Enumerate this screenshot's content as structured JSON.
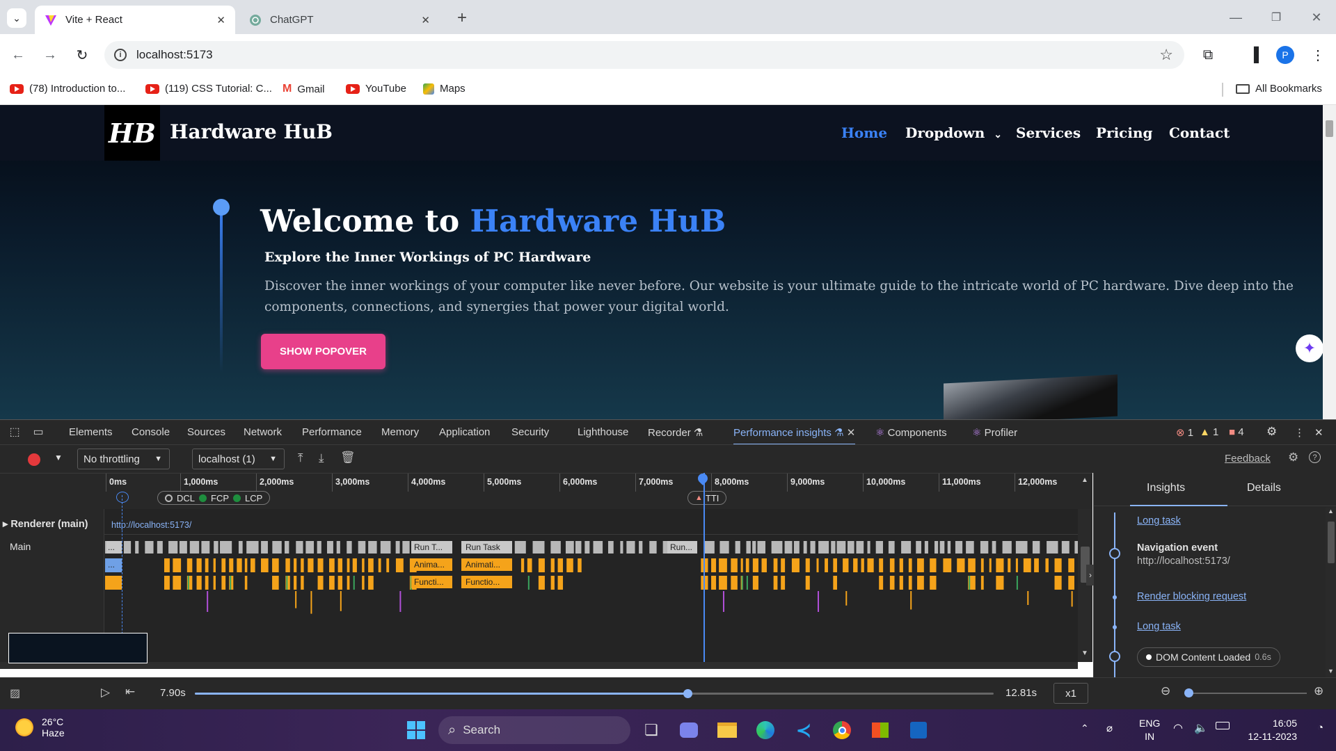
{
  "browser": {
    "tabs": [
      {
        "title": "Vite + React",
        "active": true
      },
      {
        "title": "ChatGPT",
        "active": false
      }
    ],
    "new_tab": "+",
    "url": "localhost:5173",
    "profile_initial": "P",
    "bookmarks": [
      {
        "label": "(78) Introduction to...",
        "icon": "youtube-icon"
      },
      {
        "label": "(119) CSS Tutorial: C...",
        "icon": "youtube-icon"
      },
      {
        "label": "Gmail",
        "icon": "gmail-icon"
      },
      {
        "label": "YouTube",
        "icon": "youtube-icon"
      },
      {
        "label": "Maps",
        "icon": "maps-icon"
      }
    ],
    "all_bookmarks": "All Bookmarks"
  },
  "site": {
    "logo_text": "HB",
    "brand": "Hardware HuB",
    "nav": [
      "Home",
      "Dropdown",
      "Services",
      "Pricing",
      "Contact"
    ],
    "hero_title_plain": "Welcome to ",
    "hero_title_highlight": "Hardware HuB",
    "hero_subtitle": "Explore the Inner Workings of PC Hardware",
    "hero_description": "Discover the inner workings of your computer like never before. Our website is your ultimate guide to the intricate world of PC hardware. Dive deep into the components, connections, and synergies that power your digital world.",
    "popover_button": "SHOW POPOVER",
    "accent": "#3b82f6",
    "button_color": "#e8408a"
  },
  "devtools": {
    "tabs": [
      "Elements",
      "Console",
      "Sources",
      "Network",
      "Performance",
      "Memory",
      "Application",
      "Security",
      "Lighthouse",
      "Recorder",
      "Performance insights",
      "Components",
      "Profiler"
    ],
    "active_tab": "Performance insights",
    "errors": "1",
    "warnings": "1",
    "issues": "4",
    "throttling": "No throttling",
    "target": "localhost (1)",
    "feedback": "Feedback",
    "ruler": [
      "0ms",
      "1,000ms",
      "2,000ms",
      "3,000ms",
      "4,000ms",
      "5,000ms",
      "6,000ms",
      "7,000ms",
      "8,000ms",
      "9,000ms",
      "10,000ms",
      "11,000ms",
      "12,000ms"
    ],
    "markers": {
      "dcl": "DCL",
      "fcp": "FCP",
      "lcp": "LCP",
      "tti": "TTI"
    },
    "track_title": "Renderer (main)",
    "track_url": "http://localhost:5173/",
    "main_label": "Main",
    "main_tasks": [
      {
        "label": "Run T...",
        "row": 0
      },
      {
        "label": "Run Task",
        "row": 0
      },
      {
        "label": "Run...",
        "row": 0
      },
      {
        "label": "Anima...",
        "row": 1
      },
      {
        "label": "Animati...",
        "row": 1
      },
      {
        "label": "Functi...",
        "row": 2
      },
      {
        "label": "Functio...",
        "row": 2
      },
      {
        "label": "...",
        "row": 0
      },
      {
        "label": "...",
        "row": 1
      }
    ],
    "insights_tabs": [
      "Insights",
      "Details"
    ],
    "insights": [
      {
        "type": "link",
        "label": "Long task"
      },
      {
        "type": "event",
        "title": "Navigation event",
        "detail": "http://localhost:5173/"
      },
      {
        "type": "link",
        "label": "Render blocking request"
      },
      {
        "type": "link",
        "label": "Long task"
      },
      {
        "type": "pill",
        "label": "DOM Content Loaded",
        "value": "0.6s"
      }
    ],
    "player": {
      "current": "7.90s",
      "total": "12.81s",
      "speed": "x1",
      "progress": 0.617
    }
  },
  "taskbar": {
    "weather_temp": "26°C",
    "weather_desc": "Haze",
    "search": "Search",
    "lang1": "ENG",
    "lang2": "IN",
    "time": "16:05",
    "date": "12-11-2023"
  }
}
